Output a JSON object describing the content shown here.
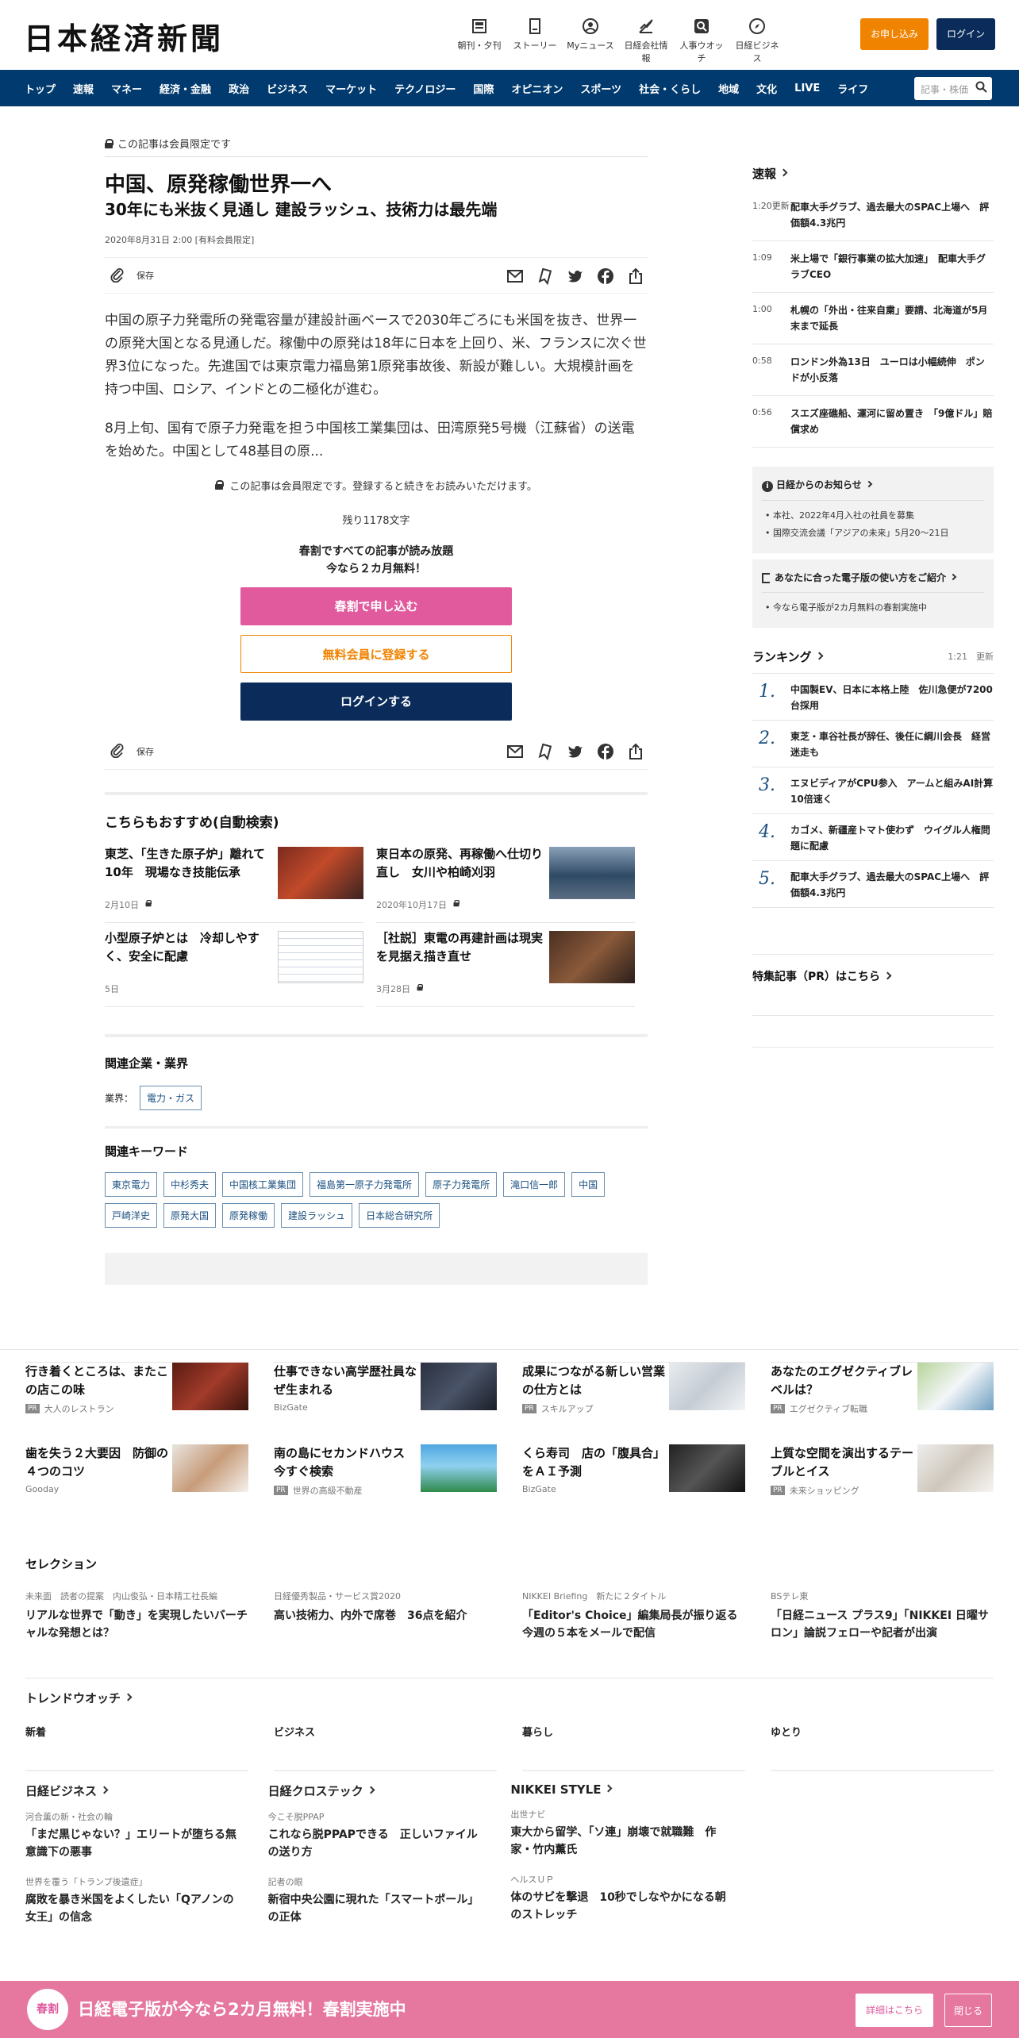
{
  "header": {
    "logo": "日本経済新聞",
    "nav": [
      {
        "label": "朝刊・夕刊",
        "icon": "newspaper-icon"
      },
      {
        "label": "ストーリー",
        "icon": "document-icon"
      },
      {
        "label": "Myニュース",
        "icon": "user-icon"
      },
      {
        "label": "日経会社情報",
        "icon": "chart-icon"
      },
      {
        "label": "人事ウオッチ",
        "icon": "search-person-icon"
      },
      {
        "label": "日経ビジネス",
        "icon": "compass-icon"
      }
    ],
    "apply": "お申し込み",
    "login": "ログイン"
  },
  "gnav": {
    "items": [
      "トップ",
      "速報",
      "マネー",
      "経済・金融",
      "政治",
      "ビジネス",
      "マーケット",
      "テクノロジー",
      "国際",
      "オピニオン",
      "スポーツ",
      "社会・くらし",
      "地域",
      "文化",
      "LIVE",
      "ライフ"
    ],
    "search_placeholder": "記事・株価"
  },
  "article": {
    "members_only": "この記事は会員限定です",
    "title": "中国、原発稼働世界一へ",
    "subtitle": "30年にも米抜く見通し 建設ラッシュ、技術力は最先端",
    "date": "2020年8月31日 2:00 [有料会員限定]",
    "save": "保存",
    "p1": "中国の原子力発電所の発電容量が建設計画ベースで2030年ごろにも米国を抜き、世界一の原発大国となる見通しだ。稼働中の原発は18年に日本を上回り、米、フランスに次ぐ世界3位になった。先進国では東京電力福島第1原発事故後、新設が難しい。大規模計画を持つ中国、ロシア、インドとの二極化が進む。",
    "p2": "8月上旬、国有で原子力発電を担う中国核工業集団は、田湾原発5号機（江蘇省）の送電を始めた。中国として48基目の原..."
  },
  "paywall": {
    "note": "この記事は会員限定です。登録すると続きをお読みいただけます。",
    "remaining": "残り1178文字",
    "promo1": "春割ですべての記事が読み放題",
    "promo2": "今なら２カ月無料！",
    "btn_spring": "春割で申し込む",
    "btn_free": "無料会員に登録する",
    "btn_login": "ログインする"
  },
  "recommend": {
    "title": "こちらもおすすめ(自動検索)",
    "items": [
      {
        "title": "東芝、「生きた原子炉」離れて10年　現場なき技能伝承",
        "date": "2月10日"
      },
      {
        "title": "東日本の原発、再稼働へ仕切り直し　女川や柏崎刈羽",
        "date": "2020年10月17日"
      },
      {
        "title": "小型原子炉とは　冷却しやすく、安全に配慮",
        "date": "5日"
      },
      {
        "title": "［社説］東電の再建計画は現実を見据え描き直せ",
        "date": "3月28日"
      }
    ]
  },
  "related": {
    "companies_title": "関連企業・業界",
    "industry_label": "業界：",
    "industry": "電力・ガス",
    "keywords_title": "関連キーワード",
    "keywords": [
      "東京電力",
      "中杉秀夫",
      "中国核工業集団",
      "福島第一原子力発電所",
      "原子力発電所",
      "滝口信一郎",
      "中国",
      "戸崎洋史",
      "原発大国",
      "原発稼働",
      "建設ラッシュ",
      "日本総合研究所"
    ]
  },
  "sidebar": {
    "breaking_title": "速報",
    "breaking": [
      {
        "time": "1:20更新",
        "title": "配車大手グラブ、過去最大のSPAC上場へ　評価額4.3兆円"
      },
      {
        "time": "1:09",
        "title": "米上場で「銀行事業の拡大加速」　配車大手グラブCEO"
      },
      {
        "time": "1:00",
        "title": "札幌の「外出・往来自粛」要請、北海道が5月末まで延長"
      },
      {
        "time": "0:58",
        "title": "ロンドン外為13日　ユーロは小幅続伸　ポンドが小反落"
      },
      {
        "time": "0:56",
        "title": "スエズ座礁船、運河に留め置き　「9億ドル」賠償求め"
      }
    ],
    "notice_title": "日経からのお知らせ",
    "notices": [
      "本社、2022年4月入社の社員を募集",
      "国際交流会議「アジアの未来」5月20～21日"
    ],
    "guide_title": "あなたに合った電子版の使い方をご紹介",
    "guide": [
      "今なら電子版が2カ月無料の春割実施中"
    ],
    "ranking_title": "ランキング",
    "ranking_updated": "1:21　更新",
    "ranking": [
      {
        "n": "1.",
        "title": "中国製EV、日本に本格上陸　佐川急便が7200台採用"
      },
      {
        "n": "2.",
        "title": "東芝・車谷社長が辞任、後任に綱川会長　経営迷走も"
      },
      {
        "n": "3.",
        "title": "エヌビディアがCPU参入　アームと組みAI計算10倍速く"
      },
      {
        "n": "4.",
        "title": "カゴメ、新疆産トマト使わず　ウイグル人権問題に配慮"
      },
      {
        "n": "5.",
        "title": "配車大手グラブ、過去最大のSPAC上場へ　評価額4.3兆円"
      }
    ],
    "pr_title": "特集記事（PR）はこちら"
  },
  "ads": [
    {
      "title": "行き着くところは、またこの店この味",
      "source": "大人のレストラン",
      "pr": "PR"
    },
    {
      "title": "仕事できない高学歴社員なぜ生まれる",
      "source": "BizGate",
      "pr": ""
    },
    {
      "title": "成果につながる新しい営業の仕方とは",
      "source": "スキルアップ",
      "pr": "PR"
    },
    {
      "title": "あなたのエグゼクティブレベルは？",
      "source": "エグゼクティブ転職",
      "pr": "PR"
    },
    {
      "title": "歯を失う２大要因　防御の４つのコツ",
      "source": "Gooday",
      "pr": ""
    },
    {
      "title": "南の島にセカンドハウス　今すぐ検索",
      "source": "世界の高級不動産",
      "pr": "PR"
    },
    {
      "title": "くら寿司　店の「腹具合」をＡＩ予測",
      "source": "BizGate",
      "pr": ""
    },
    {
      "title": "上質な空間を演出するテーブルとイス",
      "source": "未来ショッピング",
      "pr": "PR"
    }
  ],
  "selection": {
    "title": "セレクション",
    "items": [
      {
        "kicker": "未来面　読者の提案　内山俊弘・日本精工社長編",
        "title": "リアルな世界で「動き」を実現したいバーチャルな発想とは？"
      },
      {
        "kicker": "日経優秀製品・サービス賞2020",
        "title": "高い技術力、内外で席巻　36点を紹介"
      },
      {
        "kicker": "NIKKEI Briefing　新たに２タイトル",
        "title": "「Editor's Choice」編集局長が振り返る今週の５本をメールで配信"
      },
      {
        "kicker": "BSテレ東",
        "title": "「日経ニュース プラス9」「NIKKEI 日曜サロン」論説フェローや記者が出演"
      }
    ]
  },
  "trend": {
    "title": "トレンドウオッチ",
    "tabs": [
      "新着",
      "ビジネス",
      "暮らし",
      "ゆとり"
    ]
  },
  "media": [
    {
      "name": "日経ビジネス",
      "items": [
        {
          "kicker": "河合薫の新・社会の輪",
          "title": "「まだ黒じゃない？」エリートが堕ちる無意識下の悪事"
        },
        {
          "kicker": "世界を覆う「トランプ後遺症」",
          "title": "腐敗を暴き米国をよくしたい「Qアノンの女王」の信念"
        }
      ]
    },
    {
      "name": "日経クロステック",
      "items": [
        {
          "kicker": "今こそ脱PPAP",
          "title": "これなら脱PPAPできる　正しいファイルの送り方"
        },
        {
          "kicker": "記者の眼",
          "title": "新宿中央公園に現れた「スマートポール」の正体"
        }
      ]
    },
    {
      "name": "NIKKEI STYLE",
      "items": [
        {
          "kicker": "出世ナビ",
          "title": "東大から留学、「ソ連」崩壊で就職難　作家・竹内薫氏"
        },
        {
          "kicker": "ヘルスＵＰ",
          "title": "体のサビを撃退　10秒でしなやかになる朝のストレッチ"
        }
      ]
    }
  ],
  "banner": {
    "icon_text": "春割",
    "text": "日経電子版が今なら2カ月無料！春割実施中",
    "details": "詳細はこちら",
    "close": "閉じる"
  },
  "colors": {
    "navy": "#003a6e",
    "orange": "#f08300",
    "pink": "#e05a9d"
  }
}
